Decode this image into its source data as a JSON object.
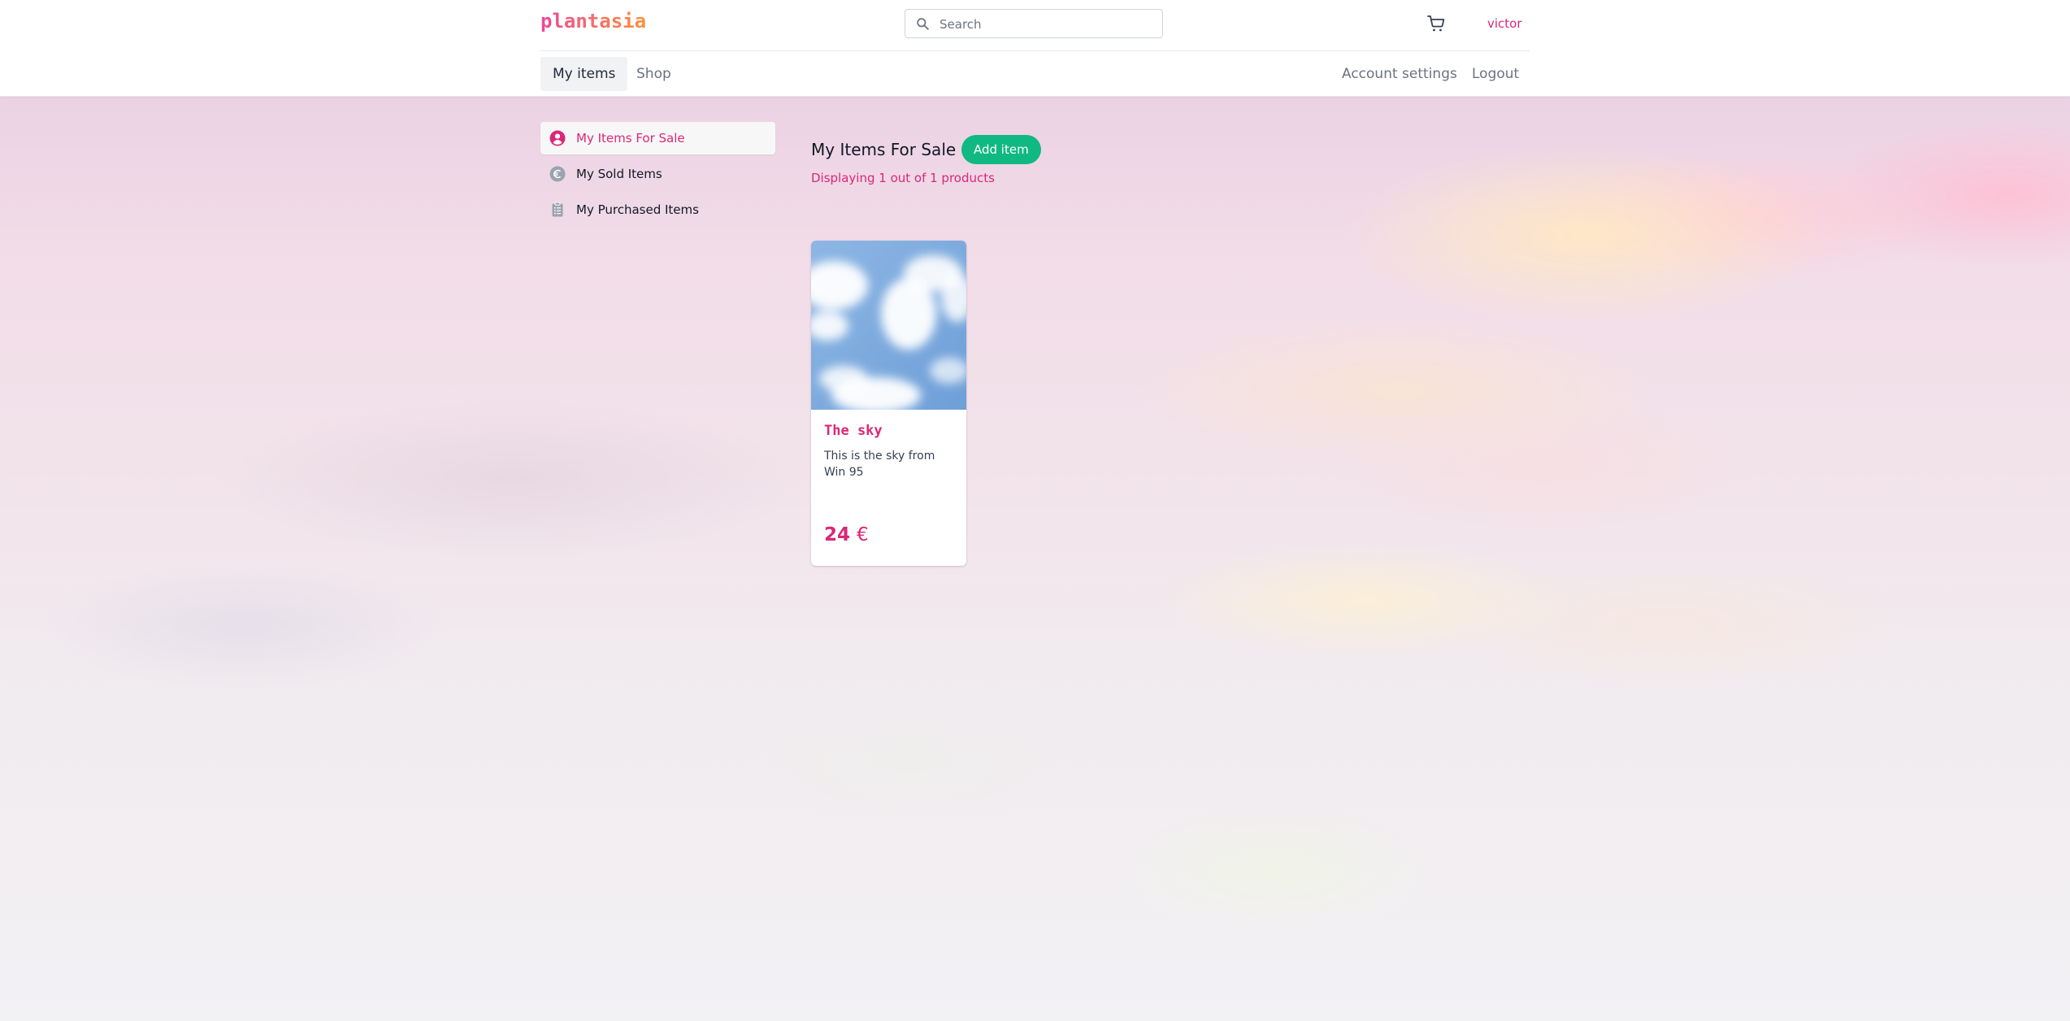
{
  "app": {
    "logo": "plantasia"
  },
  "header": {
    "search_placeholder": "Search",
    "search_value": "",
    "cart_icon": "shopping-cart-icon",
    "username": "victor"
  },
  "nav": {
    "tabs": [
      {
        "label": "My items",
        "active": true
      },
      {
        "label": "Shop",
        "active": false
      }
    ],
    "right": [
      {
        "label": "Account settings"
      },
      {
        "label": "Logout"
      }
    ]
  },
  "sidebar": {
    "items": [
      {
        "label": "My Items For Sale",
        "icon": "user-circle-icon",
        "active": true
      },
      {
        "label": "My Sold Items",
        "icon": "euro-circle-icon",
        "active": false
      },
      {
        "label": "My Purchased Items",
        "icon": "clipboard-list-icon",
        "active": false
      }
    ]
  },
  "main": {
    "title": "My Items For Sale",
    "add_button": "Add item",
    "count_text": "Displaying 1 out of 1 products",
    "products": [
      {
        "title": "The sky",
        "description": "This is the sky from Win 95",
        "price": "24",
        "currency": "€"
      }
    ]
  },
  "colors": {
    "brand_pink": "#db2777",
    "brand_orange": "#fb923c",
    "add_button_green": "#10b981",
    "sky_blue": "#7aa9dd"
  }
}
